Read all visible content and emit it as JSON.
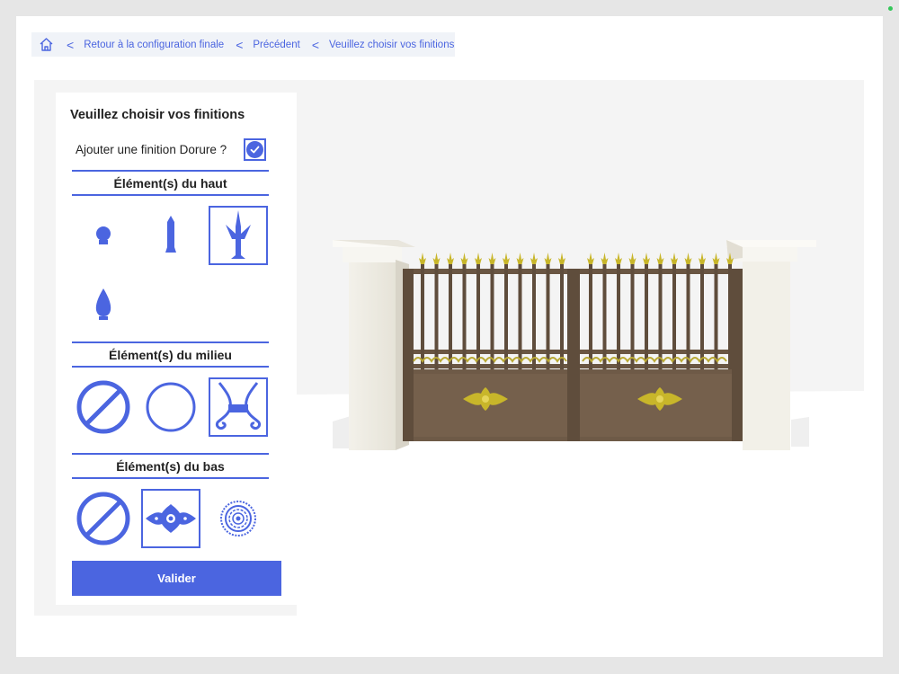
{
  "breadcrumb": {
    "items": [
      {
        "label": "Retour à la configuration finale"
      },
      {
        "label": "Précédent"
      },
      {
        "label": "Veuillez choisir vos finitions"
      }
    ]
  },
  "panel": {
    "title": "Veuillez choisir vos finitions",
    "dorure": {
      "label": "Ajouter une finition Dorure ?",
      "checked": true
    },
    "sections": [
      {
        "title": "Élément(s) du haut",
        "options": [
          "ball-finial",
          "post-finial",
          "spear-finial",
          "flame-finial"
        ],
        "selected": "spear-finial"
      },
      {
        "title": "Élément(s) du milieu",
        "options": [
          "none",
          "ring",
          "scroll-ornament"
        ],
        "selected": "scroll-ornament"
      },
      {
        "title": "Élément(s) du bas",
        "options": [
          "none",
          "rosette-ornament",
          "medallion"
        ],
        "selected": "rosette-ornament"
      }
    ],
    "submit_label": "Valider"
  },
  "colors": {
    "accent": "#4b65e0",
    "gate": "#6e5a47",
    "gold": "#c8b62a",
    "pillar": "#f2f0e8"
  }
}
